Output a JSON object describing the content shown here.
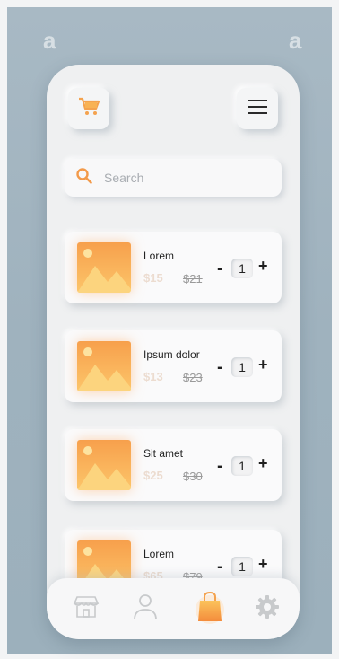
{
  "search": {
    "placeholder": "Search"
  },
  "products": [
    {
      "name": "Lorem",
      "old_price": "$15",
      "new_price": "$21",
      "quantity": "1"
    },
    {
      "name": "Ipsum dolor",
      "old_price": "$13",
      "new_price": "$23",
      "quantity": "1"
    },
    {
      "name": "Sit amet",
      "old_price": "$25",
      "new_price": "$30",
      "quantity": "1"
    },
    {
      "name": "Lorem",
      "old_price": "$65",
      "new_price": "$79",
      "quantity": "1"
    }
  ],
  "controls": {
    "minus": "-",
    "plus": "+"
  },
  "nav": {
    "items": [
      {
        "icon": "store-icon",
        "active": false
      },
      {
        "icon": "user-icon",
        "active": false
      },
      {
        "icon": "shopping-bag-icon",
        "active": true
      },
      {
        "icon": "gear-icon",
        "active": false
      }
    ]
  },
  "colors": {
    "accent": "#f7a24b",
    "accent_light": "#fbd173",
    "background": "#9fb2be",
    "surface": "#eff0f1"
  }
}
